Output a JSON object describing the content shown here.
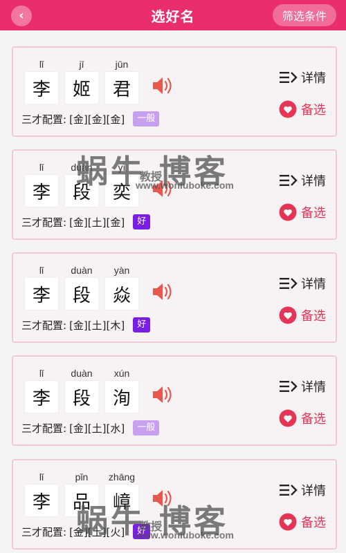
{
  "header": {
    "back_icon": "chevron-left-icon",
    "title": "选好名",
    "filter_label": "筛选条件",
    "bg_color": "#ea2d6e"
  },
  "actions": {
    "detail_label": "详情",
    "favorite_label": "备选"
  },
  "sancai_prefix": "三才配置:",
  "names": [
    {
      "chars": [
        {
          "pinyin": "lǐ",
          "char": "李"
        },
        {
          "pinyin": "jī",
          "char": "姬"
        },
        {
          "pinyin": "jūn",
          "char": "君"
        }
      ],
      "sancai": "[金][金][金]",
      "rating": "一般"
    },
    {
      "chars": [
        {
          "pinyin": "lǐ",
          "char": "李"
        },
        {
          "pinyin": "duàn",
          "char": "段"
        },
        {
          "pinyin": "yì",
          "char": "奕"
        }
      ],
      "sancai": "[金][土][金]",
      "rating": "好"
    },
    {
      "chars": [
        {
          "pinyin": "lǐ",
          "char": "李"
        },
        {
          "pinyin": "duàn",
          "char": "段"
        },
        {
          "pinyin": "yàn",
          "char": "焱"
        }
      ],
      "sancai": "[金][土][木]",
      "rating": "好"
    },
    {
      "chars": [
        {
          "pinyin": "lǐ",
          "char": "李"
        },
        {
          "pinyin": "duàn",
          "char": "段"
        },
        {
          "pinyin": "xún",
          "char": "洵"
        }
      ],
      "sancai": "[金][土][水]",
      "rating": "一般"
    },
    {
      "chars": [
        {
          "pinyin": "lǐ",
          "char": "李"
        },
        {
          "pinyin": "pǐn",
          "char": "品"
        },
        {
          "pinyin": "zhāng",
          "char": "嶂"
        }
      ],
      "sancai": "[金][土][火]",
      "rating": "好"
    }
  ],
  "watermark": {
    "main": "蜗牛 博客",
    "sub_top": "教授",
    "url": "www.woniuboke.com"
  }
}
